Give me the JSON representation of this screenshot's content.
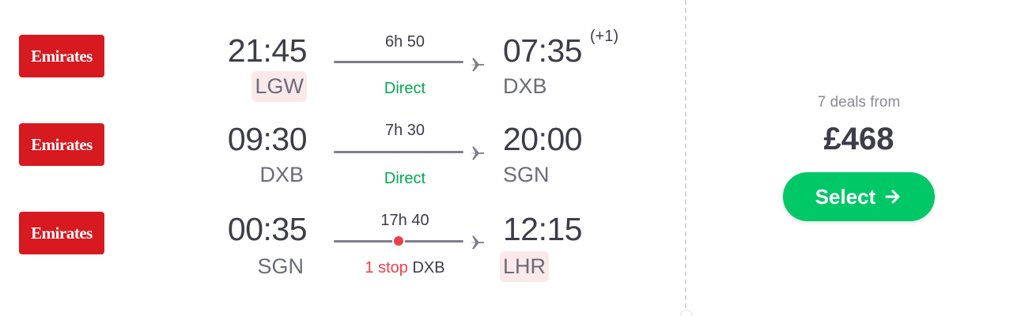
{
  "legs": [
    {
      "airline": "Emirates",
      "depart_time": "21:45",
      "depart_airport": "LGW",
      "duration": "6h 50",
      "stops_label": "Direct",
      "stop_airport": "",
      "arrive_time": "07:35",
      "arrive_day_offset": "(+1)",
      "arrive_airport": "DXB",
      "highlight_depart": true,
      "highlight_arrive": false
    },
    {
      "airline": "Emirates",
      "depart_time": "09:30",
      "depart_airport": "DXB",
      "duration": "7h 30",
      "stops_label": "Direct",
      "stop_airport": "",
      "arrive_time": "20:00",
      "arrive_day_offset": "",
      "arrive_airport": "SGN",
      "highlight_depart": false,
      "highlight_arrive": false
    },
    {
      "airline": "Emirates",
      "depart_time": "00:35",
      "depart_airport": "SGN",
      "duration": "17h 40",
      "stops_label": "1 stop",
      "stop_airport": "DXB",
      "arrive_time": "12:15",
      "arrive_day_offset": "",
      "arrive_airport": "LHR",
      "highlight_depart": false,
      "highlight_arrive": true
    }
  ],
  "price_panel": {
    "deals_text": "7 deals from",
    "price": "£468",
    "select_label": "Select"
  },
  "colors": {
    "brand_red": "#d71920",
    "direct_green": "#00a84f",
    "stop_red": "#ef3e4a",
    "select_green": "#00c867",
    "highlight_bg": "#fbe9ea"
  },
  "icons": {
    "plane": "plane-icon",
    "arrow": "arrow-right-icon"
  }
}
